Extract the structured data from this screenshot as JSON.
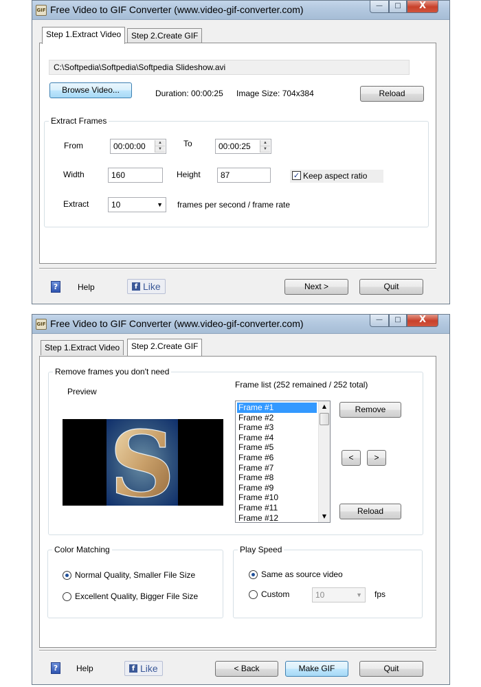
{
  "window_title": "Free Video to GIF Converter (www.video-gif-converter.com)",
  "app_icon_text": "GIF",
  "window_controls": {
    "minimize": "—",
    "maximize": "□",
    "close": "X"
  },
  "tabs": [
    {
      "label": "Step 1.Extract Video"
    },
    {
      "label": "Step 2.Create GIF"
    }
  ],
  "step1": {
    "file_path": "C:\\Softpedia\\Softpedia\\Softpedia Slideshow.avi",
    "browse_label": "Browse Video...",
    "duration": "Duration: 00:00:25",
    "image_size": "Image Size: 704x384",
    "reload_label": "Reload",
    "extract_group_title": "Extract Frames",
    "from_label": "From",
    "from_value": "00:00:00",
    "to_label": "To",
    "to_value": "00:00:25",
    "width_label": "Width",
    "width_value": "160",
    "height_label": "Height",
    "height_value": "87",
    "keep_aspect_label": "Keep aspect ratio",
    "keep_aspect_checked": true,
    "extract_label": "Extract",
    "extract_value": "10",
    "fps_label": "frames per second / frame rate"
  },
  "step2": {
    "remove_group_title": "Remove frames you don't need",
    "preview_label": "Preview",
    "preview_letter": "S",
    "frame_list_label": "Frame list (252 remained / 252 total)",
    "frames": [
      "Frame #1",
      "Frame #2",
      "Frame #3",
      "Frame #4",
      "Frame #5",
      "Frame #6",
      "Frame #7",
      "Frame #8",
      "Frame #9",
      "Frame #10",
      "Frame #11",
      "Frame #12"
    ],
    "remove_label": "Remove",
    "prev_label": "<",
    "next_label": ">",
    "reload_label": "Reload",
    "color_group_title": "Color Matching",
    "color_normal": "Normal Quality, Smaller File Size",
    "color_excellent": "Excellent Quality, Bigger File Size",
    "speed_group_title": "Play Speed",
    "speed_same": "Same as source video",
    "speed_custom": "Custom",
    "custom_value": "10",
    "fps_unit": "fps"
  },
  "footer": {
    "help_icon_glyph": "?",
    "help_label": "Help",
    "like_glyph": "f",
    "like_label": "Like",
    "next_label": "Next >",
    "back_label": "< Back",
    "make_gif_label": "Make GIF",
    "quit_label": "Quit"
  },
  "colors": {
    "selection": "#3399ff",
    "facebook": "#3b5998",
    "titlebar": "#b3c8df"
  }
}
